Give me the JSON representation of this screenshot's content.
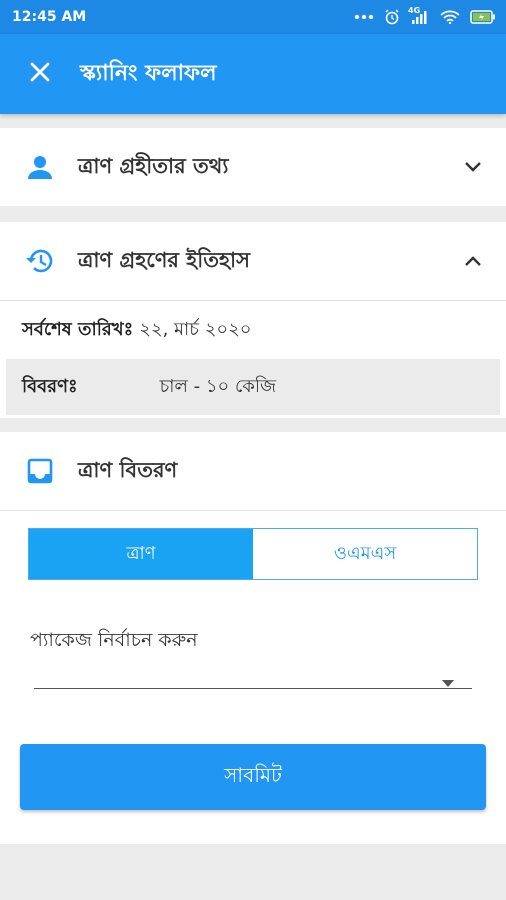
{
  "status_bar": {
    "time": "12:45 AM",
    "network_label": "4G",
    "icons": [
      "dots-icon",
      "alarm-icon",
      "signal-icon",
      "wifi-icon",
      "battery-icon"
    ]
  },
  "app_bar": {
    "title": "স্ক্যানিং ফলাফল",
    "close_icon": "close-icon"
  },
  "sections": {
    "recipient_info": {
      "title": "ত্রাণ গ্রহীতার তথ্য",
      "icon": "person-icon",
      "expanded": false
    },
    "history": {
      "title": "ত্রাণ গ্রহণের ইতিহাস",
      "icon": "history-icon",
      "expanded": true,
      "last_date_label": "সর্বশেষ তারিখঃ",
      "last_date_value": "২২, মার্চ ২০২০",
      "details_label": "বিবরণঃ",
      "details_value": "চাল - ১০ কেজি"
    },
    "distribution": {
      "title": "ত্রাণ বিতরণ",
      "icon": "inbox-icon",
      "tabs": [
        {
          "label": "ত্রাণ",
          "active": true
        },
        {
          "label": "ওএমএস",
          "active": false
        }
      ],
      "package_label": "প্যাকেজ নির্বাচন করুন",
      "package_value": "",
      "submit_label": "সাবমিট"
    }
  },
  "colors": {
    "status_bar": "#1e88e5",
    "app_bar": "#2196f3",
    "active_tab": "#1aa3f2",
    "background": "#ececec"
  }
}
